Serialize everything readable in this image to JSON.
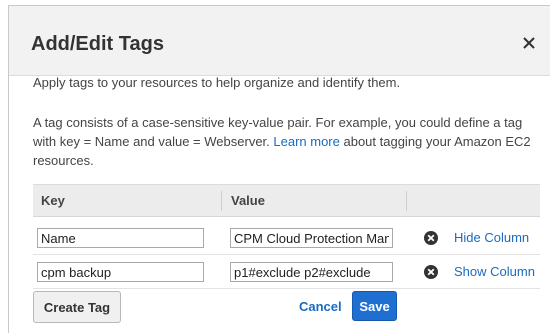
{
  "dialog": {
    "title": "Add/Edit Tags",
    "close_icon": "close-icon"
  },
  "description": {
    "line1": "Apply tags to your resources to help organize and identify them.",
    "para_before_link": "A tag consists of a case-sensitive key-value pair. For example, you could define a tag with key = Name and value = Webserver. ",
    "learn_more": "Learn more",
    "para_after_link": " about tagging your Amazon EC2 resources."
  },
  "table": {
    "headers": {
      "key": "Key",
      "value": "Value"
    },
    "rows": [
      {
        "key": "Name",
        "value": "CPM Cloud Protection Man",
        "remove_icon": "remove-circle-icon",
        "column_action": "Hide Column"
      },
      {
        "key": "cpm backup",
        "value": "p1#exclude p2#exclude",
        "remove_icon": "remove-circle-icon",
        "column_action": "Show Column"
      }
    ]
  },
  "buttons": {
    "create_tag": "Create Tag",
    "cancel": "Cancel",
    "save": "Save"
  },
  "colors": {
    "link": "#1a6bc2",
    "save_button": "#1f6fd1",
    "header_background": "#f2f2f2",
    "table_header_background": "#ececec"
  }
}
